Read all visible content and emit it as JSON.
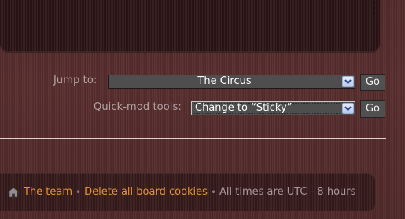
{
  "jump": {
    "label": "Jump to:",
    "selected": "The Circus",
    "go_label": "Go"
  },
  "quickmod": {
    "label": "Quick-mod tools:",
    "selected": "Change to “Sticky”",
    "go_label": "Go"
  },
  "footer": {
    "home_icon": "home-icon",
    "links": [
      "The team",
      "Delete all board cookies"
    ],
    "separator": "•",
    "timezone_text": "All times are UTC - 8 hours"
  },
  "colors": {
    "background": "#5a2f30",
    "panel": "#2f1718",
    "link": "#e39532",
    "select_bg": "#4e4e4e"
  }
}
